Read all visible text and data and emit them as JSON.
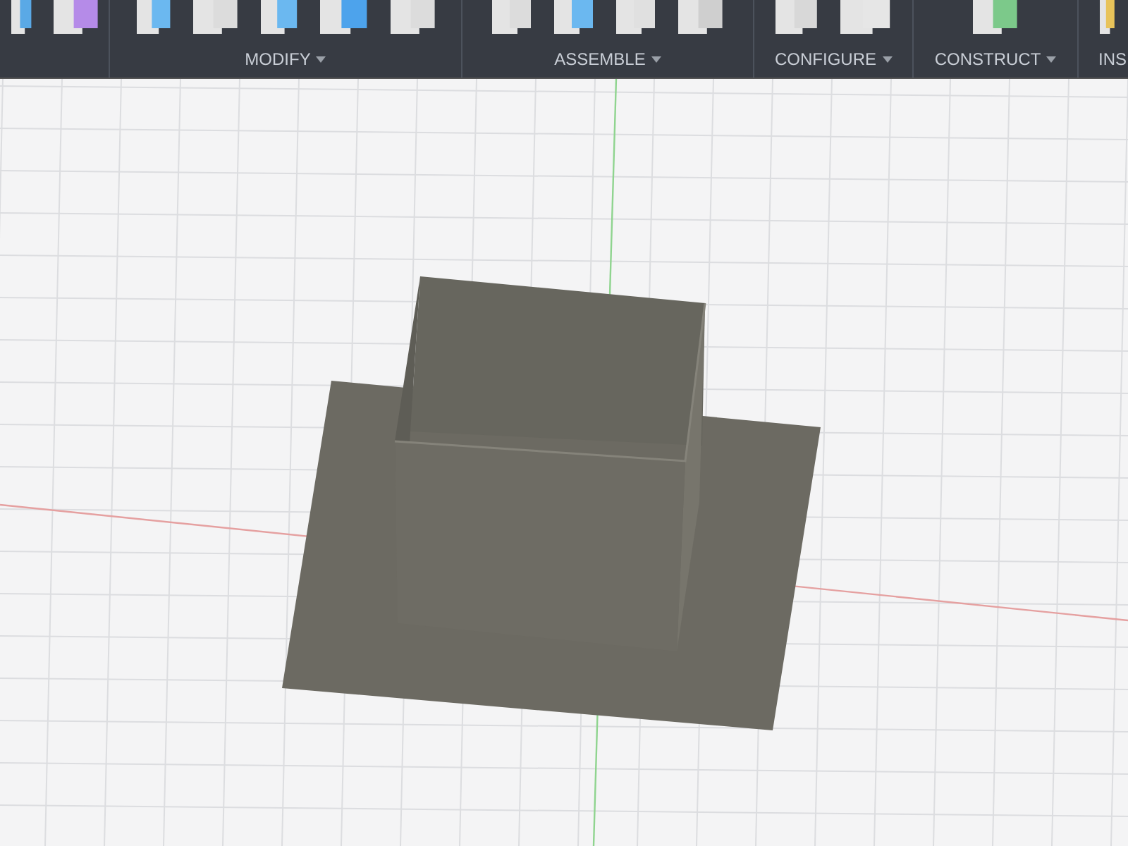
{
  "toolbar": {
    "groups": [
      {
        "dropdown": false
      },
      {
        "label": "MODIFY",
        "dropdown": true
      },
      {
        "label": "ASSEMBLE",
        "dropdown": true
      },
      {
        "label": "CONFIGURE",
        "dropdown": true
      },
      {
        "label": "CONSTRUCT",
        "dropdown": true
      },
      {
        "label": "INS",
        "dropdown": false
      }
    ]
  }
}
